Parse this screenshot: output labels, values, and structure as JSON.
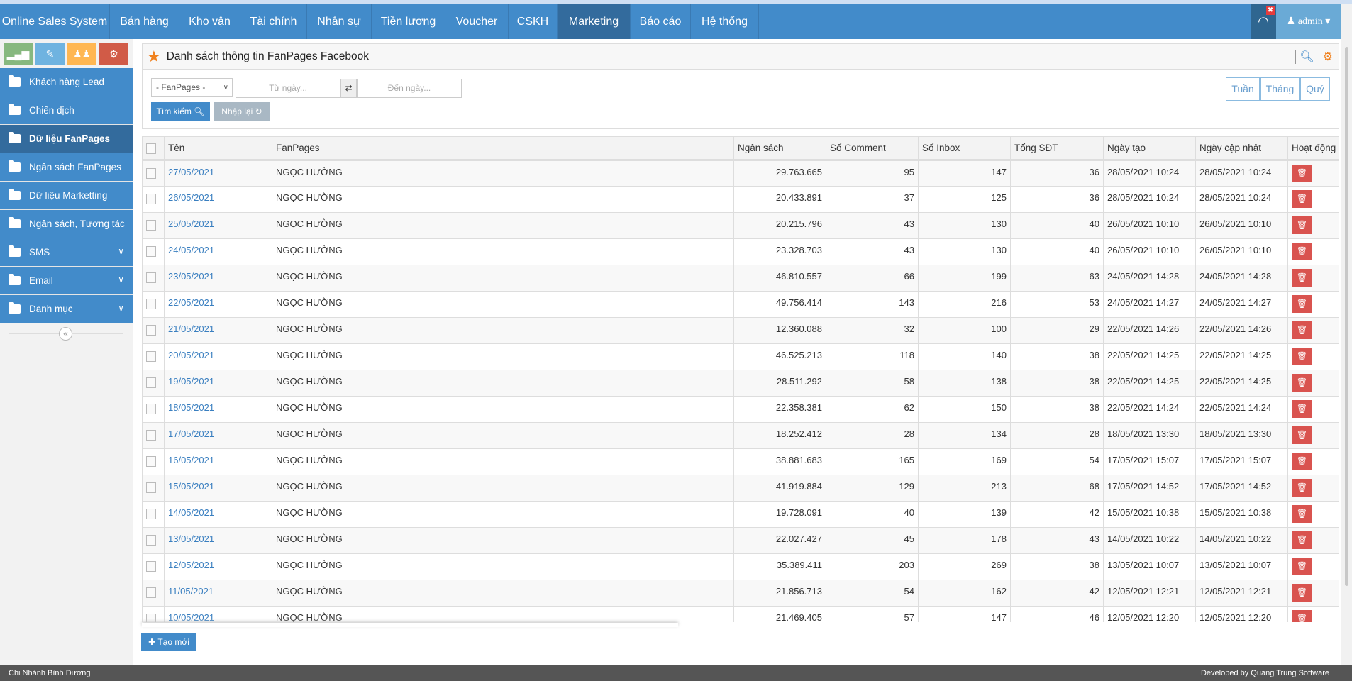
{
  "nav": {
    "brand": "Online Sales System",
    "items": [
      "Bán hàng",
      "Kho vận",
      "Tài chính",
      "Nhân sự",
      "Tiền lương",
      "Voucher",
      "CSKH",
      "Marketing",
      "Báo cáo",
      "Hệ thống"
    ],
    "active": "Marketing",
    "user": "admin"
  },
  "sidebar": {
    "items": [
      {
        "label": "Khách hàng Lead"
      },
      {
        "label": "Chiến dịch"
      },
      {
        "label": "Dữ liệu FanPages",
        "active": true
      },
      {
        "label": "Ngân sách FanPages"
      },
      {
        "label": "Dữ liệu Marketting"
      },
      {
        "label": "Ngân sách, Tương tác"
      },
      {
        "label": "SMS",
        "expandable": true
      },
      {
        "label": "Email",
        "expandable": true
      },
      {
        "label": "Danh mục",
        "expandable": true
      }
    ]
  },
  "panel": {
    "title": "Danh sách thông tin FanPages Facebook"
  },
  "filters": {
    "fanpage_select": "- FanPages -",
    "from_placeholder": "Từ ngày...",
    "to_placeholder": "Đến ngày...",
    "search_label": "Tìm kiếm",
    "reset_label": "Nhập lại",
    "periods": [
      "Tuần",
      "Tháng",
      "Quý"
    ]
  },
  "table": {
    "headers": [
      "Tên",
      "FanPages",
      "Ngân sách",
      "Số Comment",
      "Số Inbox",
      "Tổng SĐT",
      "Ngày tạo",
      "Ngày cập nhật",
      "Hoạt động"
    ],
    "rows": [
      [
        "27/05/2021",
        "NGỌC HƯỜNG",
        "29.763.665",
        "95",
        "147",
        "36",
        "28/05/2021 10:24",
        "28/05/2021 10:24"
      ],
      [
        "26/05/2021",
        "NGỌC HƯỜNG",
        "20.433.891",
        "37",
        "125",
        "36",
        "28/05/2021 10:24",
        "28/05/2021 10:24"
      ],
      [
        "25/05/2021",
        "NGỌC HƯỜNG",
        "20.215.796",
        "43",
        "130",
        "40",
        "26/05/2021 10:10",
        "26/05/2021 10:10"
      ],
      [
        "24/05/2021",
        "NGỌC HƯỜNG",
        "23.328.703",
        "43",
        "130",
        "40",
        "26/05/2021 10:10",
        "26/05/2021 10:10"
      ],
      [
        "23/05/2021",
        "NGỌC HƯỜNG",
        "46.810.557",
        "66",
        "199",
        "63",
        "24/05/2021 14:28",
        "24/05/2021 14:28"
      ],
      [
        "22/05/2021",
        "NGỌC HƯỜNG",
        "49.756.414",
        "143",
        "216",
        "53",
        "24/05/2021 14:27",
        "24/05/2021 14:27"
      ],
      [
        "21/05/2021",
        "NGỌC HƯỜNG",
        "12.360.088",
        "32",
        "100",
        "29",
        "22/05/2021 14:26",
        "22/05/2021 14:26"
      ],
      [
        "20/05/2021",
        "NGỌC HƯỜNG",
        "46.525.213",
        "118",
        "140",
        "38",
        "22/05/2021 14:25",
        "22/05/2021 14:25"
      ],
      [
        "19/05/2021",
        "NGỌC HƯỜNG",
        "28.511.292",
        "58",
        "138",
        "38",
        "22/05/2021 14:25",
        "22/05/2021 14:25"
      ],
      [
        "18/05/2021",
        "NGỌC HƯỜNG",
        "22.358.381",
        "62",
        "150",
        "38",
        "22/05/2021 14:24",
        "22/05/2021 14:24"
      ],
      [
        "17/05/2021",
        "NGỌC HƯỜNG",
        "18.252.412",
        "28",
        "134",
        "28",
        "18/05/2021 13:30",
        "18/05/2021 13:30"
      ],
      [
        "16/05/2021",
        "NGỌC HƯỜNG",
        "38.881.683",
        "165",
        "169",
        "54",
        "17/05/2021 15:07",
        "17/05/2021 15:07"
      ],
      [
        "15/05/2021",
        "NGỌC HƯỜNG",
        "41.919.884",
        "129",
        "213",
        "68",
        "17/05/2021 14:52",
        "17/05/2021 14:52"
      ],
      [
        "14/05/2021",
        "NGỌC HƯỜNG",
        "19.728.091",
        "40",
        "139",
        "42",
        "15/05/2021 10:38",
        "15/05/2021 10:38"
      ],
      [
        "13/05/2021",
        "NGỌC HƯỜNG",
        "22.027.427",
        "45",
        "178",
        "43",
        "14/05/2021 10:22",
        "14/05/2021 10:22"
      ],
      [
        "12/05/2021",
        "NGỌC HƯỜNG",
        "35.389.411",
        "203",
        "269",
        "38",
        "13/05/2021 10:07",
        "13/05/2021 10:07"
      ],
      [
        "11/05/2021",
        "NGỌC HƯỜNG",
        "21.856.713",
        "54",
        "162",
        "42",
        "12/05/2021 12:21",
        "12/05/2021 12:21"
      ],
      [
        "10/05/2021",
        "NGỌC HƯỜNG",
        "21.469.405",
        "57",
        "147",
        "46",
        "12/05/2021 12:20",
        "12/05/2021 12:20"
      ]
    ]
  },
  "create_label": "Tạo mới",
  "footer": {
    "left": "Chi Nhánh Bình Dương",
    "right": "Developed by Quang Trung Software"
  },
  "colors": {
    "primary": "#428bca",
    "active": "#336b9d",
    "danger": "#d9534f",
    "accent": "#f0811e"
  }
}
